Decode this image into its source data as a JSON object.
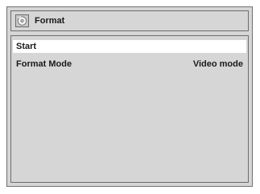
{
  "window": {
    "title": "Format",
    "title_icon": "disc-icon"
  },
  "menu": {
    "items": [
      {
        "label": "Start",
        "value": "",
        "selected": true
      },
      {
        "label": "Format Mode",
        "value": "Video mode",
        "selected": false
      }
    ]
  }
}
